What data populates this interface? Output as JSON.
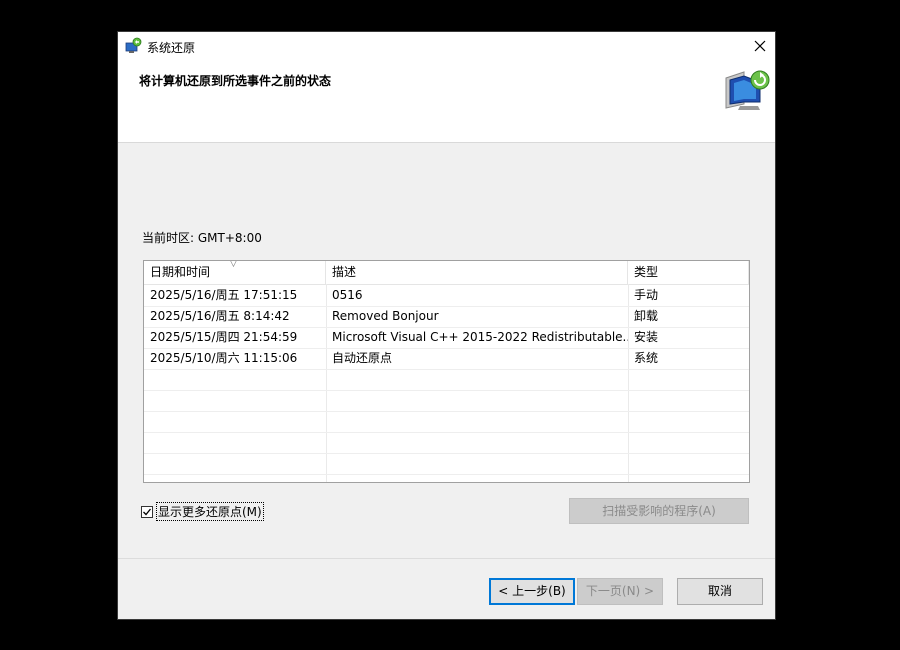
{
  "window": {
    "title": "系统还原"
  },
  "header": {
    "heading": "将计算机还原到所选事件之前的状态"
  },
  "timezone": "当前时区: GMT+8:00",
  "table": {
    "columns": [
      "日期和时间",
      "描述",
      "类型"
    ],
    "rows": [
      {
        "datetime": "2025/5/16/周五 17:51:15",
        "description": "0516",
        "type": "手动"
      },
      {
        "datetime": "2025/5/16/周五 8:14:42",
        "description": "Removed Bonjour",
        "type": "卸载"
      },
      {
        "datetime": "2025/5/15/周四 21:54:59",
        "description": "Microsoft Visual C++ 2015-2022 Redistributable...",
        "type": "安装"
      },
      {
        "datetime": "2025/5/10/周六 11:15:06",
        "description": "自动还原点",
        "type": "系统"
      }
    ]
  },
  "show_more": {
    "label": "显示更多还原点(M)",
    "checked": true
  },
  "buttons": {
    "scan": "扫描受影响的程序(A)",
    "back": "< 上一步(B)",
    "next": "下一页(N) >",
    "cancel": "取消"
  },
  "icons": {
    "close": "close-icon",
    "app": "system-restore-icon",
    "banner": "computer-restore-icon"
  },
  "colors": {
    "accent": "#0078d7",
    "disabled_bg": "#cccccc"
  }
}
